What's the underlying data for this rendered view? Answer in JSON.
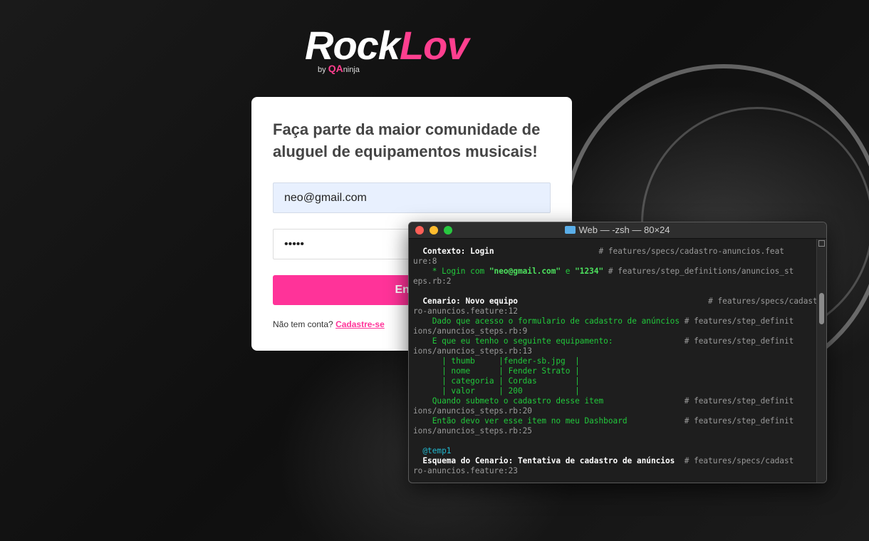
{
  "logo": {
    "word1": "Rock",
    "word2": "Lov",
    "by": "by",
    "qa": "QA",
    "ninja": "ninja"
  },
  "form": {
    "headline": "Faça parte da maior comunidade de aluguel de equipamentos musicais!",
    "email_value": "neo@gmail.com",
    "password_value": "•••••",
    "submit_label": "Entrar",
    "signup_text": "Não tem conta?",
    "signup_link": "Cadastre-se"
  },
  "terminal": {
    "title": "Web — -zsh — 80×24",
    "lines": [
      [
        [
          "w",
          "  Contexto: Login"
        ],
        [
          "c",
          "                      # features/specs/cadastro-anuncios.feat"
        ]
      ],
      [
        [
          "c",
          "ure:8"
        ]
      ],
      [
        [
          "g",
          "    * Login com "
        ],
        [
          "gb",
          "\"neo@gmail.com\""
        ],
        [
          "g",
          " e "
        ],
        [
          "gb",
          "\"1234\""
        ],
        [
          "c",
          " # features/step_definitions/anuncios_st"
        ]
      ],
      [
        [
          "c",
          "eps.rb:2"
        ]
      ],
      [
        [
          "c",
          ""
        ]
      ],
      [
        [
          "w",
          "  Cenario: Novo equipo"
        ],
        [
          "c",
          "                                        # features/specs/cadast"
        ]
      ],
      [
        [
          "c",
          "ro-anuncios.feature:12"
        ]
      ],
      [
        [
          "g",
          "    Dado que acesso o formulario de cadastro de anúncios"
        ],
        [
          "c",
          " # features/step_definit"
        ]
      ],
      [
        [
          "c",
          "ions/anuncios_steps.rb:9"
        ]
      ],
      [
        [
          "g",
          "    E que eu tenho o seguinte equipamento:"
        ],
        [
          "c",
          "               # features/step_definit"
        ]
      ],
      [
        [
          "c",
          "ions/anuncios_steps.rb:13"
        ]
      ],
      [
        [
          "g",
          "      | thumb     |fender-sb.jpg  |"
        ]
      ],
      [
        [
          "g",
          "      | nome      | Fender Strato |"
        ]
      ],
      [
        [
          "g",
          "      | categoria | Cordas        |"
        ]
      ],
      [
        [
          "g",
          "      | valor     | 200           |"
        ]
      ],
      [
        [
          "g",
          "    Quando submeto o cadastro desse item"
        ],
        [
          "c",
          "                 # features/step_definit"
        ]
      ],
      [
        [
          "c",
          "ions/anuncios_steps.rb:20"
        ]
      ],
      [
        [
          "g",
          "    Então devo ver esse item no meu Dashboard"
        ],
        [
          "c",
          "            # features/step_definit"
        ]
      ],
      [
        [
          "c",
          "ions/anuncios_steps.rb:25"
        ]
      ],
      [
        [
          "c",
          ""
        ]
      ],
      [
        [
          "t",
          "  @temp1"
        ]
      ],
      [
        [
          "w",
          "  Esquema do Cenario: Tentativa de cadastro de anúncios"
        ],
        [
          "c",
          "  # features/specs/cadast"
        ]
      ],
      [
        [
          "c",
          "ro-anuncios.feature:23"
        ]
      ]
    ]
  }
}
